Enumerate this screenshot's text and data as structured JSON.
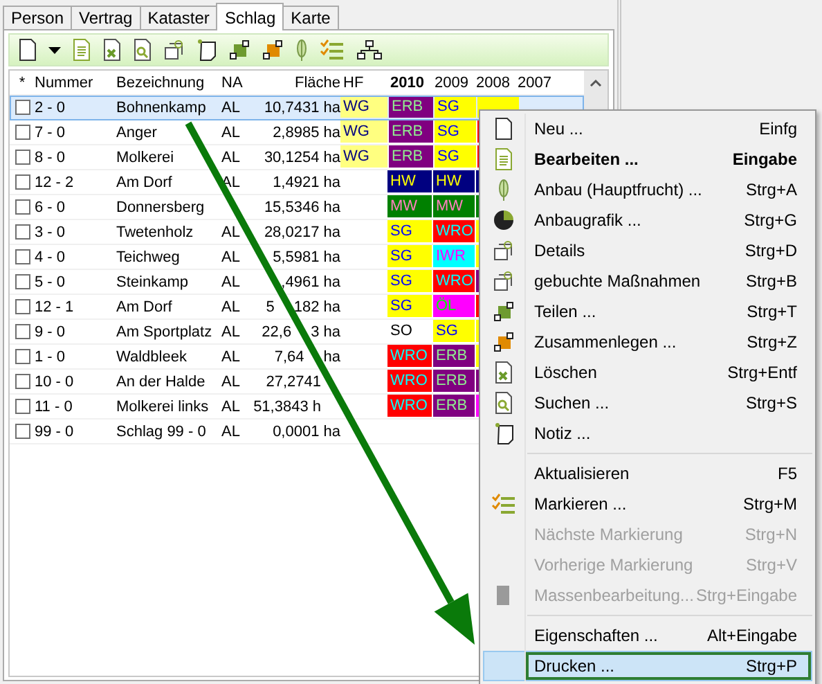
{
  "tabs": [
    {
      "label": "Person",
      "selected": false
    },
    {
      "label": "Vertrag",
      "selected": false
    },
    {
      "label": "Kataster",
      "selected": false
    },
    {
      "label": "Schlag",
      "selected": true
    },
    {
      "label": "Karte",
      "selected": false
    }
  ],
  "table": {
    "columns": [
      {
        "label": "*",
        "bold": false
      },
      {
        "label": "Nummer",
        "bold": false
      },
      {
        "label": "Bezeichnung",
        "bold": false
      },
      {
        "label": "NA",
        "bold": false
      },
      {
        "label": "Fläche",
        "bold": false
      },
      {
        "label": "HF",
        "bold": false
      },
      {
        "label": "2010",
        "bold": true
      },
      {
        "label": "2009",
        "bold": false
      },
      {
        "label": "2008",
        "bold": false
      },
      {
        "label": "2007",
        "bold": false
      }
    ],
    "rows": [
      {
        "selected": true,
        "checked": false,
        "number": "2 - 0",
        "name": "Bohnenkamp",
        "na": "AL",
        "area": [
          {
            "kind": "text",
            "text": "10,7431 ha"
          }
        ],
        "hf": {
          "text": "WG",
          "color": "#ffff80"
        },
        "years": [
          {
            "text": "ERB",
            "color": "#800080"
          },
          {
            "text": "SG",
            "color": "#ffff00"
          },
          {
            "color": "#ffff00"
          }
        ]
      },
      {
        "selected": false,
        "checked": false,
        "number": "7 - 0",
        "name": "Anger",
        "na": "AL",
        "area": [
          {
            "kind": "text",
            "text": "2,8985 ha"
          }
        ],
        "hf": {
          "text": "WG",
          "color": "#ffff80"
        },
        "years": [
          {
            "text": "ERB",
            "color": "#800080"
          },
          {
            "text": "SG",
            "color": "#ffff00"
          },
          {
            "color": "#ff0000"
          }
        ]
      },
      {
        "selected": false,
        "checked": false,
        "number": "8 - 0",
        "name": "Molkerei",
        "na": "AL",
        "area": [
          {
            "kind": "text",
            "text": "30,1254 ha"
          }
        ],
        "hf": {
          "text": "WG",
          "color": "#ffff80"
        },
        "years": [
          {
            "text": "ERB",
            "color": "#800080"
          },
          {
            "text": "SG",
            "color": "#ffff00"
          },
          {
            "color": "#ff0000"
          }
        ]
      },
      {
        "selected": false,
        "checked": false,
        "number": "12 - 2",
        "name": "Am Dorf",
        "na": "AL",
        "area": [
          {
            "kind": "text",
            "text": "1,4921 ha"
          }
        ],
        "years": [
          {
            "text": "HW",
            "color": "#000080"
          },
          {
            "text": "HW",
            "color": "#000080"
          },
          {
            "color": "#000080"
          }
        ]
      },
      {
        "selected": false,
        "checked": false,
        "number": "6 - 0",
        "name": "Donnersberg",
        "area": [
          {
            "kind": "text",
            "text": "15,5346 ha"
          }
        ],
        "years": [
          {
            "text": "MW",
            "color": "#008000"
          },
          {
            "text": "MW",
            "color": "#008000"
          },
          {
            "color": "#008000"
          }
        ]
      },
      {
        "selected": false,
        "checked": false,
        "number": "3 - 0",
        "name": "Twetenholz",
        "na": "AL",
        "area": [
          {
            "kind": "text",
            "text": "28,0217 ha"
          }
        ],
        "years": [
          {
            "text": "SG",
            "color": "#ffff00"
          },
          {
            "text": "WRO",
            "color": "#ff0000"
          },
          {
            "color": "#ffff00"
          }
        ]
      },
      {
        "selected": false,
        "checked": false,
        "number": "4 - 0",
        "name": "Teichweg",
        "na": "AL",
        "area": [
          {
            "kind": "covered"
          },
          {
            "kind": "text",
            "text": "5,5981 ha"
          }
        ],
        "years": [
          {
            "text": "SG",
            "color": "#ffff00"
          },
          {
            "text": "IWR",
            "color": "#00ffff"
          },
          {
            "color": "#ffff00"
          }
        ]
      },
      {
        "selected": false,
        "checked": false,
        "number": "5 - 0",
        "name": "Steinkamp",
        "na": "AL",
        "area": [
          {
            "kind": "covered"
          },
          {
            "kind": "text",
            "text": ",4961 ha"
          }
        ],
        "years": [
          {
            "text": "SG",
            "color": "#ffff00"
          },
          {
            "text": "WRO",
            "color": "#ff0000"
          },
          {
            "color": "#800080"
          }
        ]
      },
      {
        "selected": false,
        "checked": false,
        "number": "12 - 1",
        "name": "Am Dorf",
        "na": "AL",
        "area": [
          {
            "kind": "text",
            "text": "5"
          },
          {
            "kind": "covered"
          },
          {
            "kind": "text",
            "text": "182 ha"
          }
        ],
        "years": [
          {
            "text": "SG",
            "color": "#ffff00"
          },
          {
            "text": "ÖL",
            "color": "#ff00ff"
          },
          {
            "color": "#ff0000"
          }
        ]
      },
      {
        "selected": false,
        "checked": false,
        "number": "9 - 0",
        "name": "Am Sportplatz",
        "na": "AL",
        "area": [
          {
            "kind": "text",
            "text": "22,6"
          },
          {
            "kind": "covered"
          },
          {
            "kind": "text",
            "text": "3 ha"
          }
        ],
        "years": [
          {
            "text": "SO",
            "color": "#ffffff"
          },
          {
            "text": "SG",
            "color": "#ffff00"
          },
          {
            "color": "#ffff00"
          }
        ]
      },
      {
        "selected": false,
        "checked": false,
        "number": "1 - 0",
        "name": "Waldbleek",
        "na": "AL",
        "area": [
          {
            "kind": "text",
            "text": "7,64"
          },
          {
            "kind": "covered"
          },
          {
            "kind": "text",
            "text": "ha"
          }
        ],
        "years": [
          {
            "text": "WRO",
            "color": "#ff0000"
          },
          {
            "text": "ERB",
            "color": "#800080"
          },
          {
            "color": "#ffff00"
          }
        ]
      },
      {
        "selected": false,
        "checked": false,
        "number": "10 - 0",
        "name": "An der Halde",
        "na": "AL",
        "area": [
          {
            "kind": "text",
            "text": "27,2741"
          },
          {
            "kind": "covered"
          }
        ],
        "years": [
          {
            "text": "WRO",
            "color": "#ff0000"
          },
          {
            "text": "ERB",
            "color": "#800080"
          },
          {
            "color": "#800080"
          }
        ]
      },
      {
        "selected": false,
        "checked": false,
        "number": "11 - 0",
        "name": "Molkerei links",
        "na": "AL",
        "area": [
          {
            "kind": "text",
            "text": "51,3843 h"
          },
          {
            "kind": "covered"
          }
        ],
        "years": [
          {
            "text": "WRO",
            "color": "#ff0000"
          },
          {
            "text": "ERB",
            "color": "#800080"
          },
          {
            "color": "#ff00ff"
          }
        ]
      },
      {
        "selected": false,
        "checked": false,
        "number": "99 - 0",
        "name": "Schlag 99 - 0",
        "na": "AL",
        "area": [
          {
            "kind": "text",
            "text": "0,0001 ha"
          }
        ],
        "years": []
      }
    ]
  },
  "context_menu": {
    "groups": [
      [
        {
          "label": "Neu ...",
          "shortcut": "Einfg",
          "bold": false,
          "disabled": false,
          "selected": false
        },
        {
          "label": "Bearbeiten ...",
          "shortcut": "Eingabe",
          "bold": true,
          "disabled": false,
          "selected": false
        },
        {
          "label": "Anbau (Hauptfrucht) ...",
          "shortcut": "Strg+A",
          "bold": false,
          "disabled": false,
          "selected": false
        },
        {
          "label": "Anbaugrafik ...",
          "shortcut": "Strg+G",
          "bold": false,
          "disabled": false,
          "selected": false
        },
        {
          "label": "Details",
          "shortcut": "Strg+D",
          "bold": false,
          "disabled": false,
          "selected": false
        },
        {
          "label": "gebuchte Maßnahmen",
          "shortcut": "Strg+B",
          "bold": false,
          "disabled": false,
          "selected": false
        },
        {
          "label": "Teilen ...",
          "shortcut": "Strg+T",
          "bold": false,
          "disabled": false,
          "selected": false
        },
        {
          "label": "Zusammenlegen ...",
          "shortcut": "Strg+Z",
          "bold": false,
          "disabled": false,
          "selected": false
        },
        {
          "label": "Löschen",
          "shortcut": "Strg+Entf",
          "bold": false,
          "disabled": false,
          "selected": false
        },
        {
          "label": "Suchen ...",
          "shortcut": "Strg+S",
          "bold": false,
          "disabled": false,
          "selected": false
        },
        {
          "label": "Notiz ...",
          "bold": false,
          "disabled": false,
          "selected": false
        }
      ],
      [
        {
          "label": "Aktualisieren",
          "shortcut": "F5",
          "bold": false,
          "disabled": false,
          "selected": false
        },
        {
          "label": "Markieren ...",
          "shortcut": "Strg+M",
          "bold": false,
          "disabled": false,
          "selected": false
        },
        {
          "label": "Nächste Markierung",
          "shortcut": "Strg+N",
          "bold": false,
          "disabled": true,
          "selected": false
        },
        {
          "label": "Vorherige Markierung",
          "shortcut": "Strg+V",
          "bold": false,
          "disabled": true,
          "selected": false
        },
        {
          "label": "Massenbearbeitung...",
          "shortcut": "Strg+Eingabe",
          "bold": false,
          "disabled": true,
          "selected": false
        }
      ],
      [
        {
          "label": "Eigenschaften ...",
          "shortcut": "Alt+Eingabe",
          "bold": false,
          "disabled": false,
          "selected": false
        },
        {
          "label": "Drucken ...",
          "shortcut": "Strg+P",
          "bold": false,
          "disabled": false,
          "selected": true
        }
      ]
    ]
  }
}
